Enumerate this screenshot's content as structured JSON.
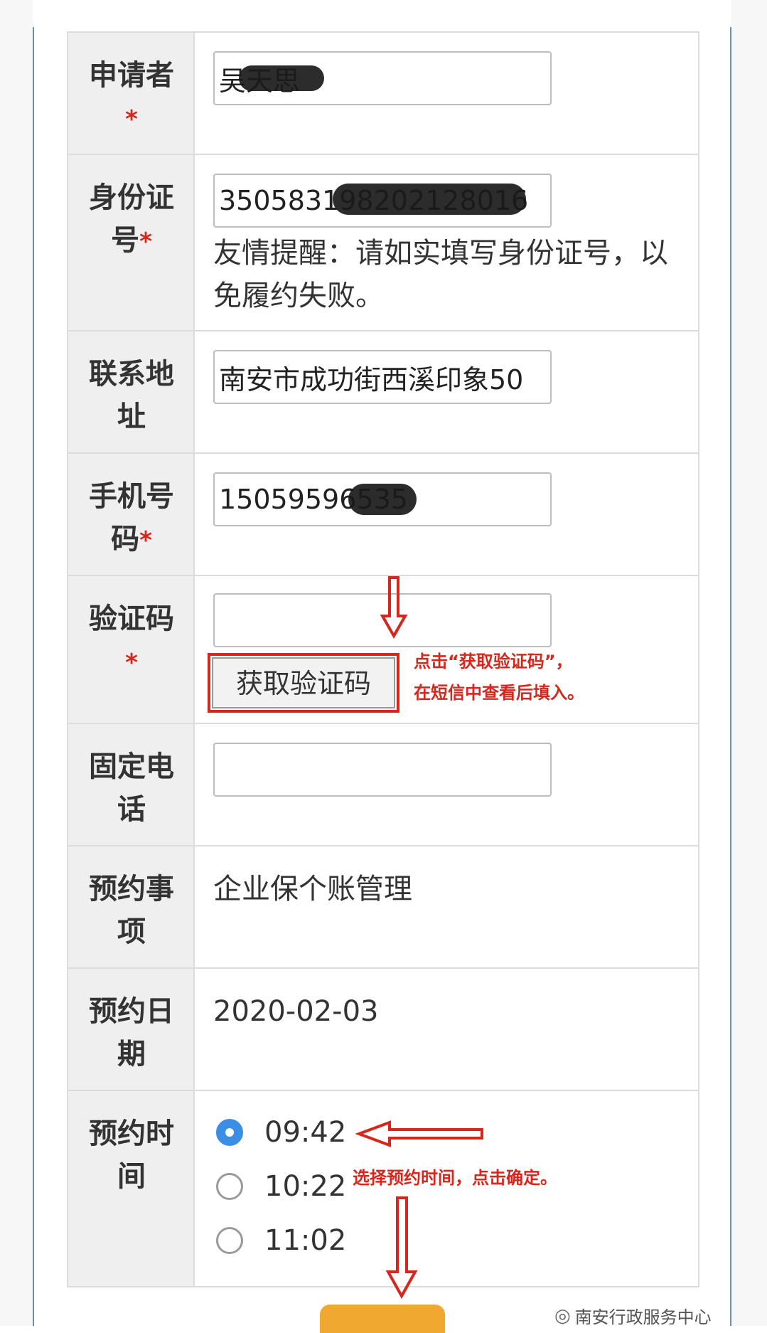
{
  "form": {
    "applicant": {
      "label": "申请者",
      "value": "吴天思"
    },
    "id_number": {
      "label": "身份证号",
      "value": "350583198202128016",
      "hint": "友情提醒：请如实填写身份证号，以免履约失败。"
    },
    "address": {
      "label": "联系地址",
      "value": "南安市成功街西溪印象50"
    },
    "mobile": {
      "label": "手机号码",
      "value": "15059596535"
    },
    "verify_code": {
      "label": "验证码",
      "value": "",
      "button_label": "获取验证码"
    },
    "landline": {
      "label": "固定电话",
      "value": ""
    },
    "item": {
      "label": "预约事项",
      "value": "企业保个账管理"
    },
    "date": {
      "label": "预约日期",
      "value": "2020-02-03"
    },
    "time": {
      "label": "预约时间",
      "options": [
        "09:42",
        "10:22",
        "11:02"
      ],
      "selected": "09:42"
    },
    "required_mark": "*"
  },
  "annotations": {
    "code_hint_line1": "点击“获取验证码”，",
    "code_hint_line2": "在短信中查看后填入。",
    "time_hint": "选择预约时间，点击确定。"
  },
  "watermark": {
    "text": "南安行政服务中心",
    "icon": "wechat-icon"
  },
  "colors": {
    "annotation_red": "#d9261c",
    "radio_blue": "#3a8ee6",
    "submit_orange": "#f0a830"
  }
}
